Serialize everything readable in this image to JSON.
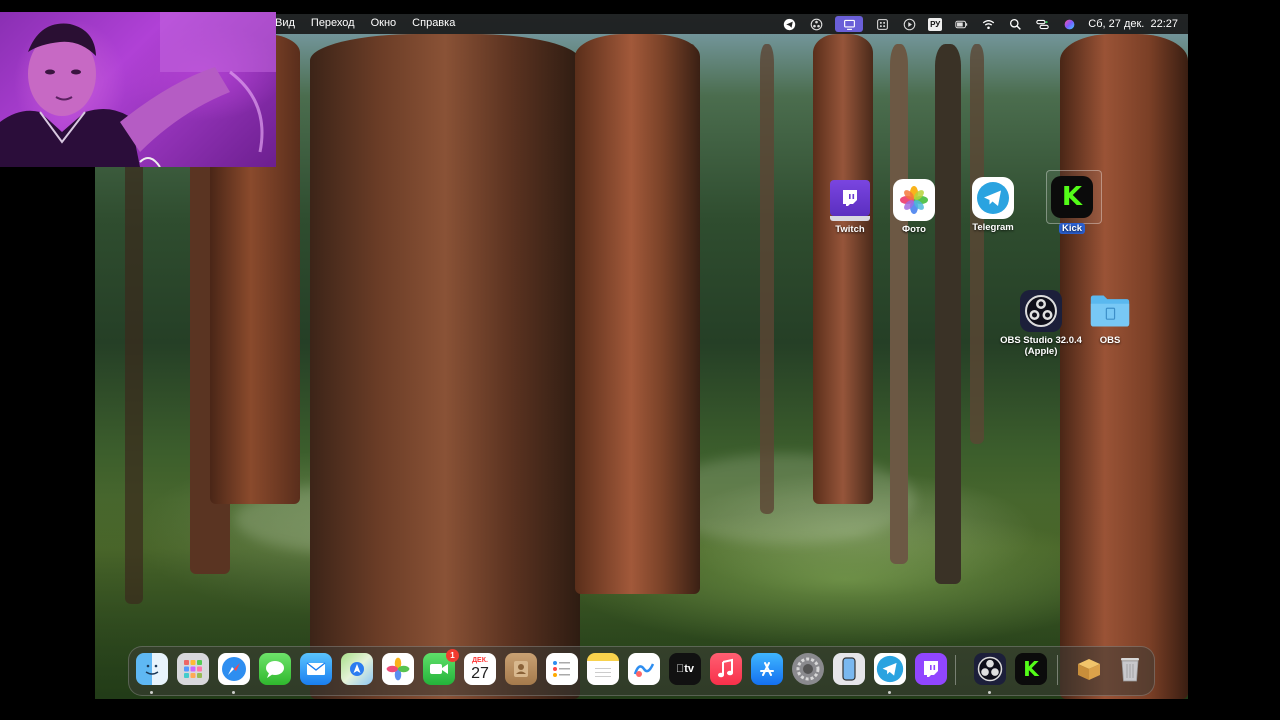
{
  "menubar": {
    "items": [
      "Вид",
      "Переход",
      "Окно",
      "Справка"
    ],
    "language": "РУ",
    "datetime": "Сб, 27 дек.  22:27"
  },
  "desktop": {
    "icons": [
      {
        "label": "Twitch",
        "icon": "twitch-icon"
      },
      {
        "label": "Фото",
        "icon": "photos-icon"
      },
      {
        "label": "Telegram",
        "icon": "telegram-icon"
      },
      {
        "label": "Kick",
        "icon": "kick-icon",
        "selected": true
      },
      {
        "label": "OBS Studio 32.0.4 (Apple)",
        "icon": "obs-icon"
      },
      {
        "label": "OBS",
        "icon": "folder-icon"
      }
    ]
  },
  "dock": {
    "apps": [
      "finder",
      "launchpad",
      "safari",
      "messages",
      "mail",
      "maps",
      "photos",
      "facetime",
      "calendar",
      "contacts",
      "reminders",
      "notes",
      "freeform",
      "tv",
      "music",
      "app-store",
      "system-settings",
      "iphone-mirroring",
      "telegram",
      "twitch",
      "obs",
      "kick",
      "archive-utility",
      "trash"
    ],
    "facetime_badge": "1",
    "calendar_month": "ДЕК.",
    "calendar_day": "27",
    "tv_label": "tv"
  },
  "colors": {
    "menubar_active": "#6a5fd8",
    "selection": "#2a5fd0",
    "twitch": "#9146ff",
    "kick": "#53fc18",
    "telegram": "#2aa3e0",
    "folder": "#5ab8ef"
  }
}
